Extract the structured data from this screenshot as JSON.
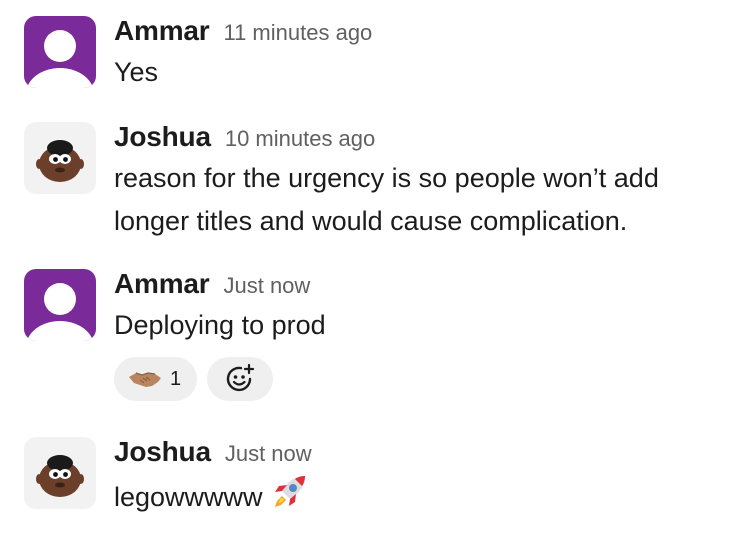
{
  "messages": [
    {
      "author": "Ammar",
      "timestamp": "11 minutes ago",
      "text": "Yes",
      "avatar": "default-user-avatar"
    },
    {
      "author": "Joshua",
      "timestamp": "10 minutes ago",
      "text": "reason for the urgency is so people won’t add longer titles and would cause complication.",
      "avatar": "memoji-avatar"
    },
    {
      "author": "Ammar",
      "timestamp": "Just now",
      "text": "Deploying to prod",
      "avatar": "default-user-avatar",
      "reactions": [
        {
          "emoji": "handshake-icon",
          "count": "1"
        }
      ]
    },
    {
      "author": "Joshua",
      "timestamp": "Just now",
      "text": "legowwwww",
      "avatar": "memoji-avatar",
      "trailing_emoji": "rocket-icon"
    }
  ],
  "colors": {
    "avatar_purple": "#7b2a9a",
    "avatar_light": "#f2f2f2",
    "timestamp": "#616061",
    "reaction_bg": "#efefef"
  }
}
